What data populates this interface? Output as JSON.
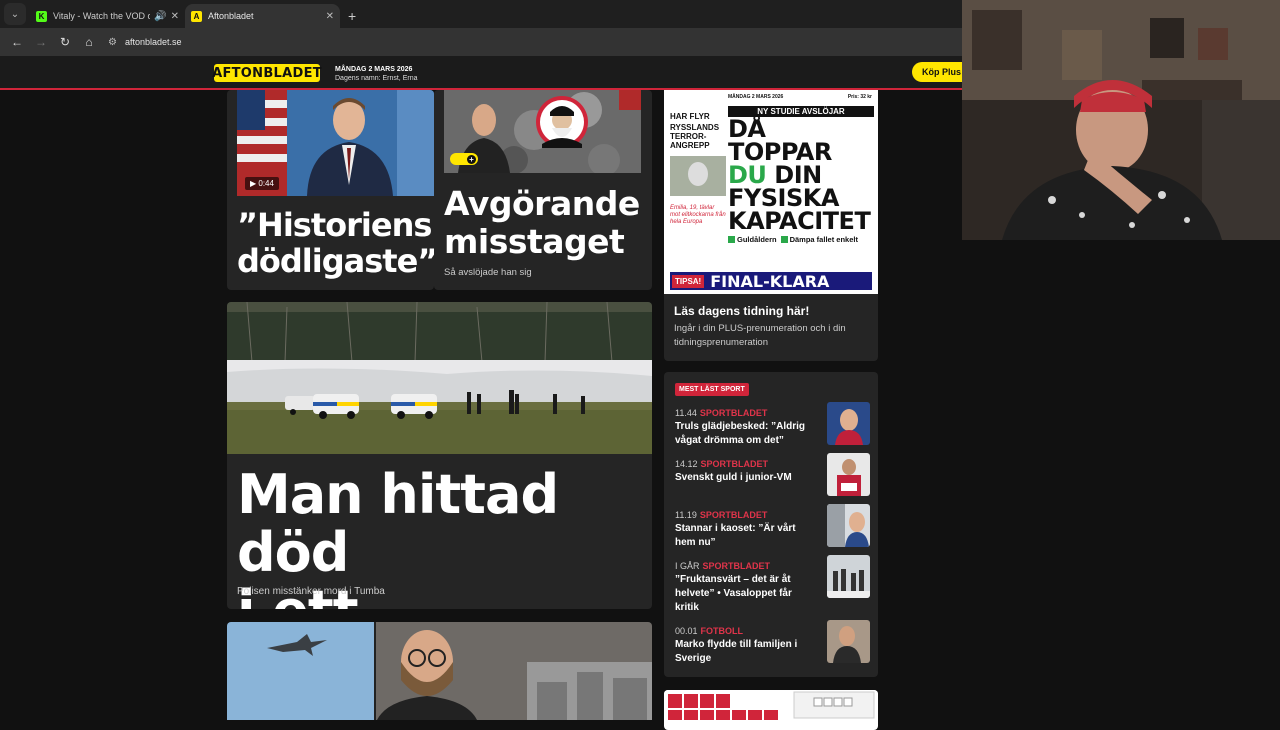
{
  "browser": {
    "tabs": [
      {
        "title": "Vitaly - Watch the VOD on K",
        "favicon": "K",
        "audio": "🔊"
      },
      {
        "title": "Aftonbladet",
        "favicon": "A"
      }
    ],
    "url": "aftonbladet.se"
  },
  "header": {
    "logo": "AFTONBLADET",
    "date": "MÅNDAG 2 MARS 2026",
    "namesday": "Dagens namn: Ernst, Erna",
    "buy_button": "Köp Plus"
  },
  "articles": {
    "a1": {
      "headline_line1": "”Historiens",
      "headline_line2": "dödligaste”",
      "video_duration": "▶ 0:44"
    },
    "a2": {
      "headline_line1": "Avgörande",
      "headline_line2": "misstaget",
      "sub": "Så avslöjade han sig",
      "plus": "+"
    },
    "a3": {
      "headline_line1": "Man hittad död",
      "headline_line2": "i ett vattendrag",
      "sub": "Polisen misstänker mord i Tumba"
    }
  },
  "newspaper": {
    "date": "MÅNDAG 2 MARS 2026",
    "price": "Pris: 32 kr",
    "banner": "NY STUDIE AVSLÖJAR",
    "big_line1": "DÅ TOPPAR",
    "big_line2a": "DU",
    "big_line2b": " DIN",
    "big_line3": "FYSISKA",
    "big_line4": "KAPACITET",
    "tag1": "Guldåldern",
    "tag2": "Dämpa fallet enkelt",
    "left_title": "HAR FLYR",
    "left_sub": "RYSSLANDS TERROR-ANGREPP",
    "left_caption": "Emilia, 19, tävlar mot elitkockarna från hela Europa",
    "tipsa": "TIPSA!",
    "final": "FINAL-KLARA",
    "caption_title": "Läs dagens tidning här!",
    "caption_sub": "Ingår i din PLUS-prenumeration och i din tidningsprenumeration"
  },
  "mostread": {
    "badge": "MEST LÄST SPORT",
    "items": [
      {
        "time": "11.44",
        "category": "SPORTBLADET",
        "title": "Truls glädjebesked: ”Aldrig vågat drömma om det”"
      },
      {
        "time": "14.12",
        "category": "SPORTBLADET",
        "title": "Svenskt guld i junior-VM"
      },
      {
        "time": "11.19",
        "category": "SPORTBLADET",
        "title": "Stannar i kaoset: ”Är vårt hem nu”"
      },
      {
        "time": "I GÅR",
        "category": "SPORTBLADET",
        "title": "”Fruktansvärt – det är åt helvete” • Vasaloppet får kritik"
      },
      {
        "time": "00.01",
        "category": "FOTBOLL",
        "title": "Marko flydde till familjen i Sverige"
      }
    ]
  },
  "colors": {
    "accent": "#d0253a",
    "logo_yellow": "#ffe600",
    "card_bg": "#252525"
  }
}
